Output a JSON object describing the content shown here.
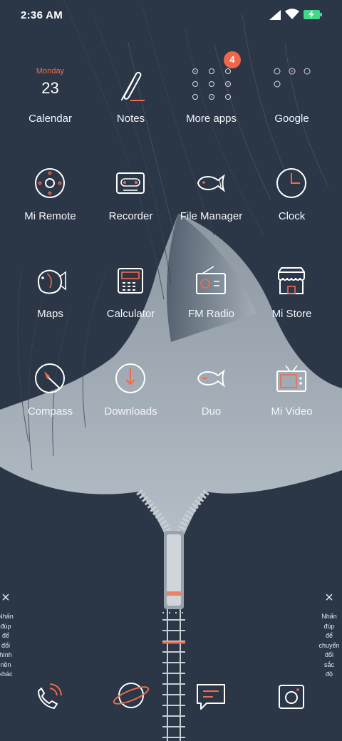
{
  "status_bar": {
    "time": "2:36 AM",
    "icons": [
      "signal-icon",
      "wifi-icon",
      "battery-charging-icon"
    ]
  },
  "calendar_widget": {
    "month": "Monday",
    "day": "23"
  },
  "apps": [
    {
      "label": "Calendar",
      "icon": "calendar-icon"
    },
    {
      "label": "Notes",
      "icon": "notes-icon"
    },
    {
      "label": "More apps",
      "icon": "more-apps-folder-icon",
      "badge": "4"
    },
    {
      "label": "Google",
      "icon": "google-folder-icon"
    },
    {
      "label": "Mi Remote",
      "icon": "remote-icon"
    },
    {
      "label": "Recorder",
      "icon": "cassette-icon"
    },
    {
      "label": "File Manager",
      "icon": "fish-icon"
    },
    {
      "label": "Clock",
      "icon": "clock-icon"
    },
    {
      "label": "Maps",
      "icon": "goldfish-icon"
    },
    {
      "label": "Calculator",
      "icon": "calculator-icon"
    },
    {
      "label": "FM Radio",
      "icon": "radio-icon"
    },
    {
      "label": "Mi Store",
      "icon": "store-icon"
    },
    {
      "label": "Compass",
      "icon": "compass-icon"
    },
    {
      "label": "Downloads",
      "icon": "download-icon"
    },
    {
      "label": "Duo",
      "icon": "fish-icon"
    },
    {
      "label": "Mi Video",
      "icon": "tv-icon"
    }
  ],
  "hints": {
    "left": {
      "close": "×",
      "lines": [
        "Nhấn",
        "đúp",
        "để",
        "đổi",
        "hình",
        "nền",
        "khác"
      ]
    },
    "right": {
      "close": "×",
      "lines": [
        "Nhấn",
        "đúp",
        "để",
        "chuyển",
        "đổi",
        "sắc",
        "độ"
      ]
    }
  },
  "dock": [
    "phone-icon",
    "browser-planet-icon",
    "messages-icon",
    "camera-icon"
  ],
  "colors": {
    "background": "#2b3647",
    "accent": "#ef6b4d",
    "line": "#ffffff"
  }
}
